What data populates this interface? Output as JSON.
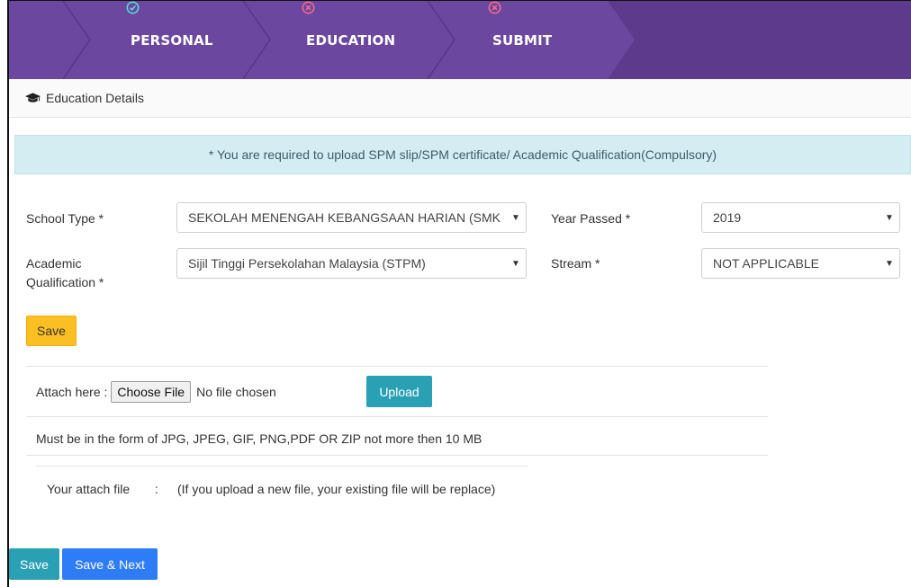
{
  "stepper": {
    "steps": [
      {
        "label": "PERSONAL",
        "status": "complete"
      },
      {
        "label": "EDUCATION",
        "status": "incomplete"
      },
      {
        "label": "SUBMIT",
        "status": "incomplete"
      }
    ],
    "colors": {
      "background": "#5e3a8c",
      "active": "#6b47a0",
      "complete_icon": "#5ee0d8",
      "incomplete_icon": "#ff6b8a"
    }
  },
  "section": {
    "icon": "graduation-cap-icon",
    "title": "Education Details"
  },
  "alert": {
    "text": "* You are required to upload SPM slip/SPM certificate/ Academic Qualification(Compulsory)"
  },
  "form": {
    "school_type": {
      "label": "School Type *",
      "value": "SEKOLAH MENENGAH KEBANGSAAN HARIAN (SMK"
    },
    "year_passed": {
      "label": "Year Passed *",
      "value": "2019"
    },
    "academic_qualification": {
      "label_line1": "Academic",
      "label_line2": "Qualification *",
      "value": "Sijil Tinggi Persekolahan Malaysia (STPM)"
    },
    "stream": {
      "label": "Stream *",
      "value": "NOT APPLICABLE"
    },
    "save_label": "Save"
  },
  "attachment": {
    "label": "Attach here :",
    "choose_file_label": "Choose File",
    "file_status": "No file chosen",
    "upload_label": "Upload",
    "format_note": "Must be in the form of JPG, JPEG, GIF, PNG,PDF OR ZIP not more then 10 MB",
    "your_file_label": "Your attach file",
    "separator": ":",
    "replace_note": "(If you upload a new file, your existing file will be replace)"
  },
  "footer": {
    "save_label": "Save",
    "save_next_label": "Save & Next"
  }
}
